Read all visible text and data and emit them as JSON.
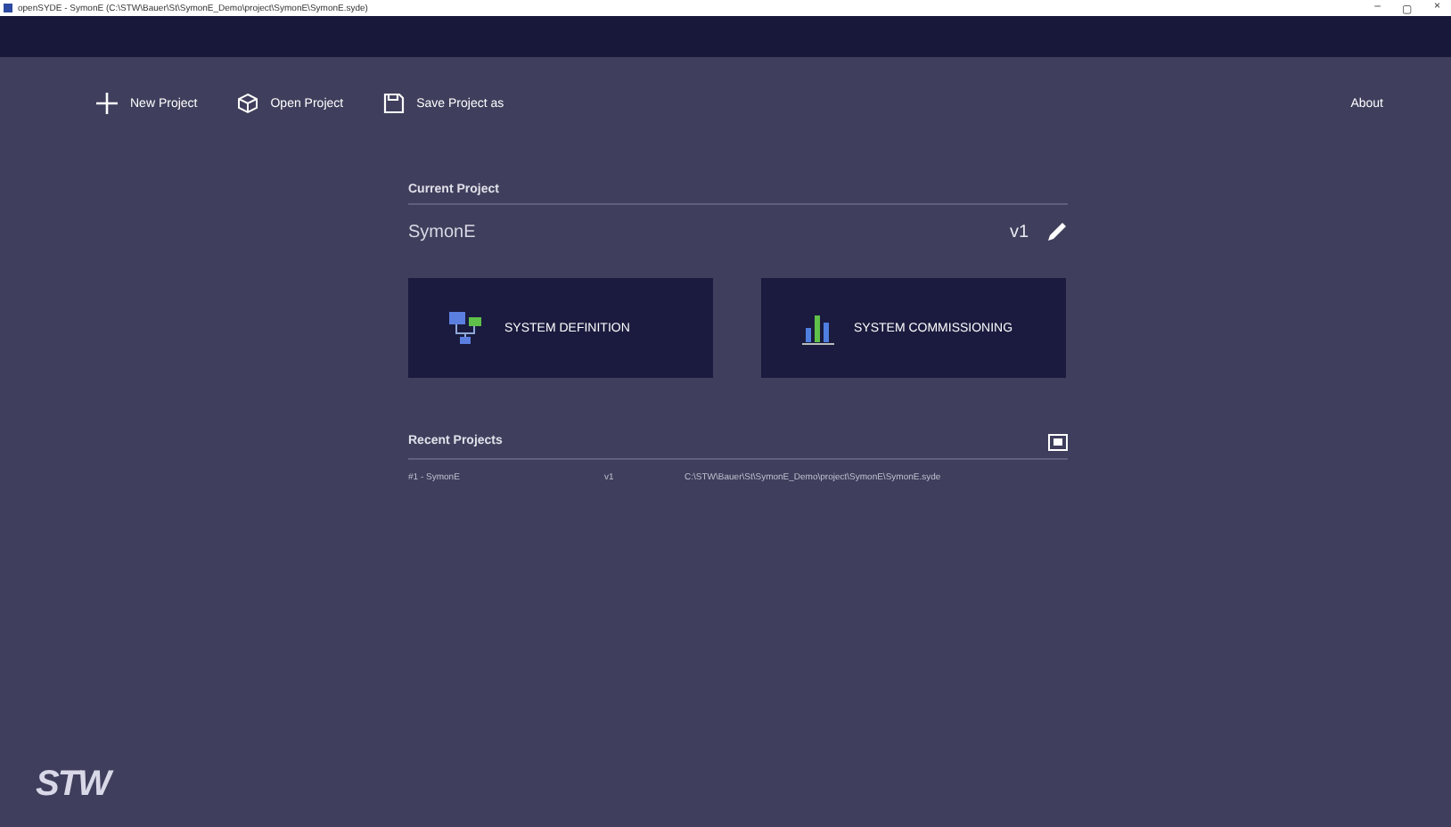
{
  "window": {
    "title": "openSYDE - SymonE (C:\\STW\\Bauer\\St\\SymonE_Demo\\project\\SymonE\\SymonE.syde)",
    "controls": [
      "–",
      "▢",
      "×"
    ]
  },
  "toolbar": {
    "items": [
      {
        "label": "New Project",
        "kind": "new"
      },
      {
        "label": "Open Project",
        "kind": "open"
      },
      {
        "label": "Save Project as",
        "kind": "save"
      }
    ],
    "about": "About"
  },
  "current_project": {
    "heading": "Current Project",
    "name": "SymonE",
    "version": "v1"
  },
  "tiles": [
    {
      "label": "SYSTEM DEFINITION",
      "kind": "definition"
    },
    {
      "label": "SYSTEM COMMISSIONING",
      "kind": "commissioning"
    }
  ],
  "recent_projects": {
    "heading": "Recent Projects",
    "rows": [
      {
        "name": "#1 - SymonE",
        "version": "v1",
        "path": "C:\\STW\\Bauer\\St\\SymonE_Demo\\project\\SymonE\\SymonE.syde"
      }
    ]
  },
  "logo": "STW"
}
